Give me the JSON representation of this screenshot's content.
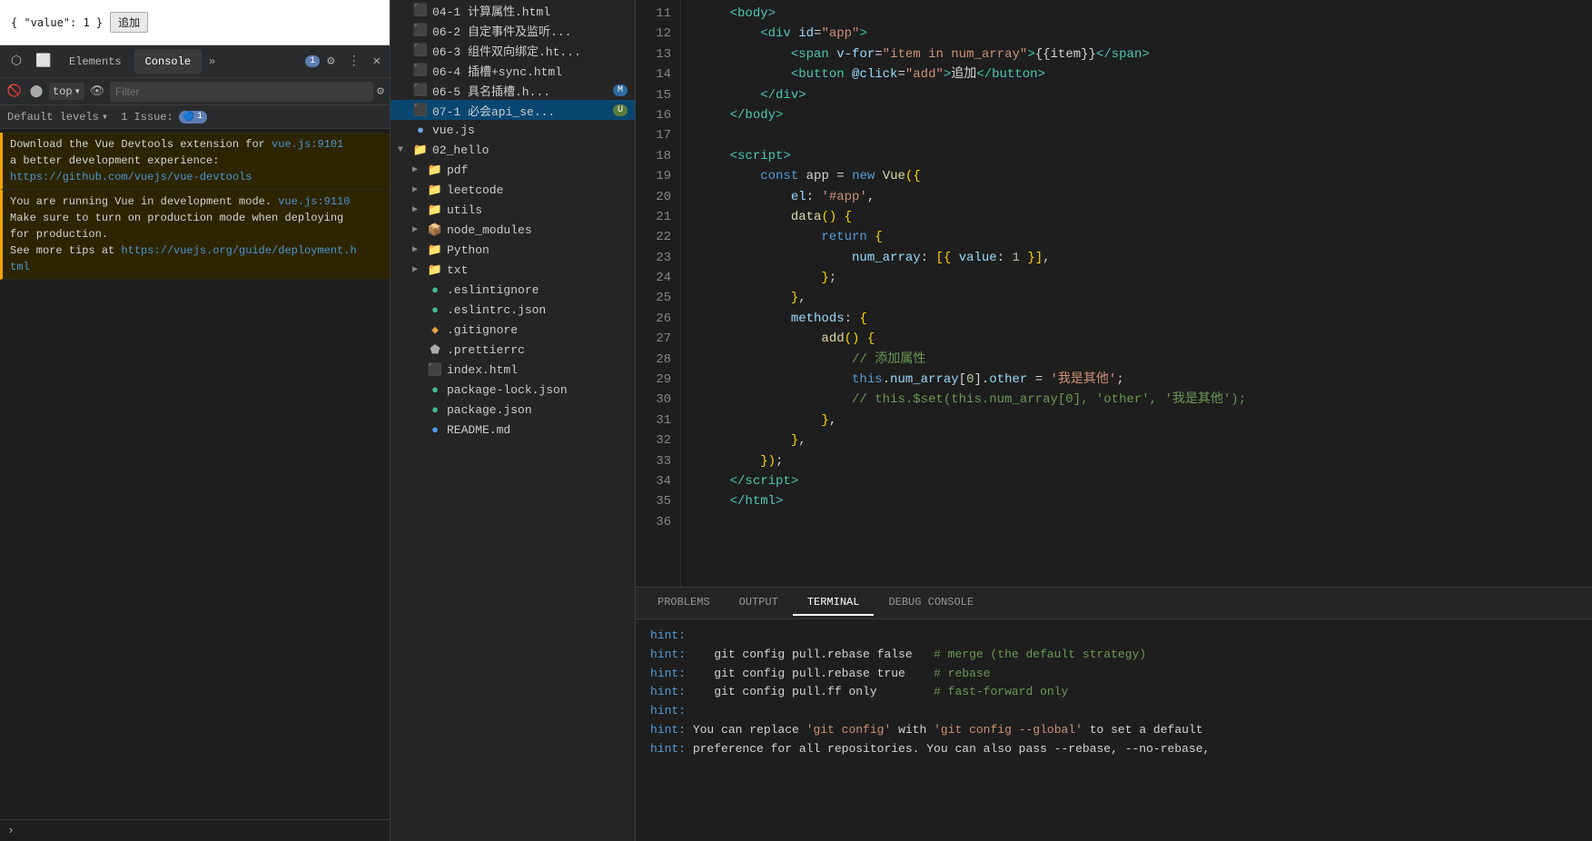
{
  "devtools": {
    "preview": {
      "text": "{ \"value\": 1 }",
      "button": "追加"
    },
    "tabs": {
      "icons": [
        "☰",
        "⬜"
      ],
      "items": [
        "Elements",
        "Console"
      ],
      "active": "Console",
      "badge": "1",
      "more": "»"
    },
    "console_toolbar": {
      "top_label": "top",
      "filter_placeholder": "Filter"
    },
    "levels": {
      "label": "Default levels",
      "caret": "▾",
      "issues_text": "1 Issue:",
      "issues_badge": "1"
    },
    "messages": [
      {
        "type": "warning",
        "lines": [
          "Download the Vue Devtools extension for a better development experience:",
          ""
        ],
        "link1_text": "vue.js:9101",
        "link1_url": "#",
        "link2_text": "https://github.com/vuejs/vue-devtools",
        "link2_url": "#"
      },
      {
        "type": "warning",
        "lines": [
          "You are running Vue in development mode. ",
          "Make sure to turn on production mode when deploying for production.",
          "See more tips at "
        ],
        "link1_text": "vue.js:9110",
        "link2_text": "https://vuejs.org/guide/deployment.html"
      }
    ]
  },
  "file_tree": {
    "items": [
      {
        "indent": 0,
        "type": "file",
        "color": "#e8a44a",
        "name": "04-1 计算属性.html",
        "arrow": ""
      },
      {
        "indent": 0,
        "type": "file",
        "color": "#e8a44a",
        "name": "06-2 自定事件及监听...",
        "arrow": ""
      },
      {
        "indent": 0,
        "type": "file",
        "color": "#e8a44a",
        "name": "06-3 组件双向绑定.ht...",
        "arrow": ""
      },
      {
        "indent": 0,
        "type": "file",
        "color": "#e8a44a",
        "name": "06-4 插槽+sync.html",
        "arrow": ""
      },
      {
        "indent": 0,
        "type": "file",
        "color": "#e8a44a",
        "name": "06-5 具名插槽.h...",
        "arrow": "",
        "badge": "M"
      },
      {
        "indent": 0,
        "type": "file",
        "color": "#e8a44a",
        "name": "07-1 必会api_se...",
        "arrow": "",
        "badge": "U",
        "active": true
      },
      {
        "indent": 0,
        "type": "file",
        "color": "#6ea8e0",
        "name": "vue.js",
        "arrow": ""
      },
      {
        "indent": 0,
        "type": "folder",
        "name": "02_hello",
        "arrow": "▼",
        "open": true
      },
      {
        "indent": 1,
        "type": "folder",
        "name": "pdf",
        "arrow": "▶"
      },
      {
        "indent": 1,
        "type": "folder",
        "name": "leetcode",
        "arrow": "▶"
      },
      {
        "indent": 1,
        "type": "folder",
        "name": "utils",
        "arrow": "▶"
      },
      {
        "indent": 1,
        "type": "folder_special",
        "name": "node_modules",
        "arrow": "▶"
      },
      {
        "indent": 1,
        "type": "folder",
        "name": "Python",
        "arrow": "▶"
      },
      {
        "indent": 1,
        "type": "folder",
        "name": "txt",
        "arrow": "▶"
      },
      {
        "indent": 1,
        "type": "file",
        "color": "#4aba90",
        "name": ".eslintignore",
        "arrow": ""
      },
      {
        "indent": 1,
        "type": "file",
        "color": "#4aba90",
        "name": ".eslintrc.json",
        "arrow": ""
      },
      {
        "indent": 1,
        "type": "file",
        "color": "#e8a44a",
        "name": ".gitignore",
        "arrow": ""
      },
      {
        "indent": 1,
        "type": "file",
        "color": "#aaaaaa",
        "name": ".prettierrc",
        "arrow": ""
      },
      {
        "indent": 1,
        "type": "file",
        "color": "#e8a44a",
        "name": "index.html",
        "arrow": ""
      },
      {
        "indent": 1,
        "type": "file",
        "color": "#4aba90",
        "name": "package-lock.json",
        "arrow": ""
      },
      {
        "indent": 1,
        "type": "file",
        "color": "#4aba90",
        "name": "package.json",
        "arrow": ""
      },
      {
        "indent": 1,
        "type": "file",
        "color": "#4e9ee8",
        "name": "README.md",
        "arrow": ""
      }
    ]
  },
  "editor": {
    "lines": [
      11,
      12,
      13,
      14,
      15,
      16,
      17,
      18,
      19,
      20,
      21,
      22,
      23,
      24,
      25,
      26,
      27,
      28,
      29,
      30,
      31,
      32,
      33,
      34,
      35,
      36
    ]
  },
  "terminal": {
    "tabs": [
      "PROBLEMS",
      "OUTPUT",
      "TERMINAL",
      "DEBUG CONSOLE"
    ],
    "active_tab": "TERMINAL",
    "lines": [
      "hint:",
      "hint:    git config pull.rebase false   # merge (the default strategy)",
      "hint:    git config pull.rebase true    # rebase",
      "hint:    git config pull.ff only        # fast-forward only",
      "hint:",
      "hint: You can replace 'git config' with 'git config --global' to set a default",
      "hint: preference for all repositories. You can also pass --rebase, --no-rebase,"
    ]
  }
}
